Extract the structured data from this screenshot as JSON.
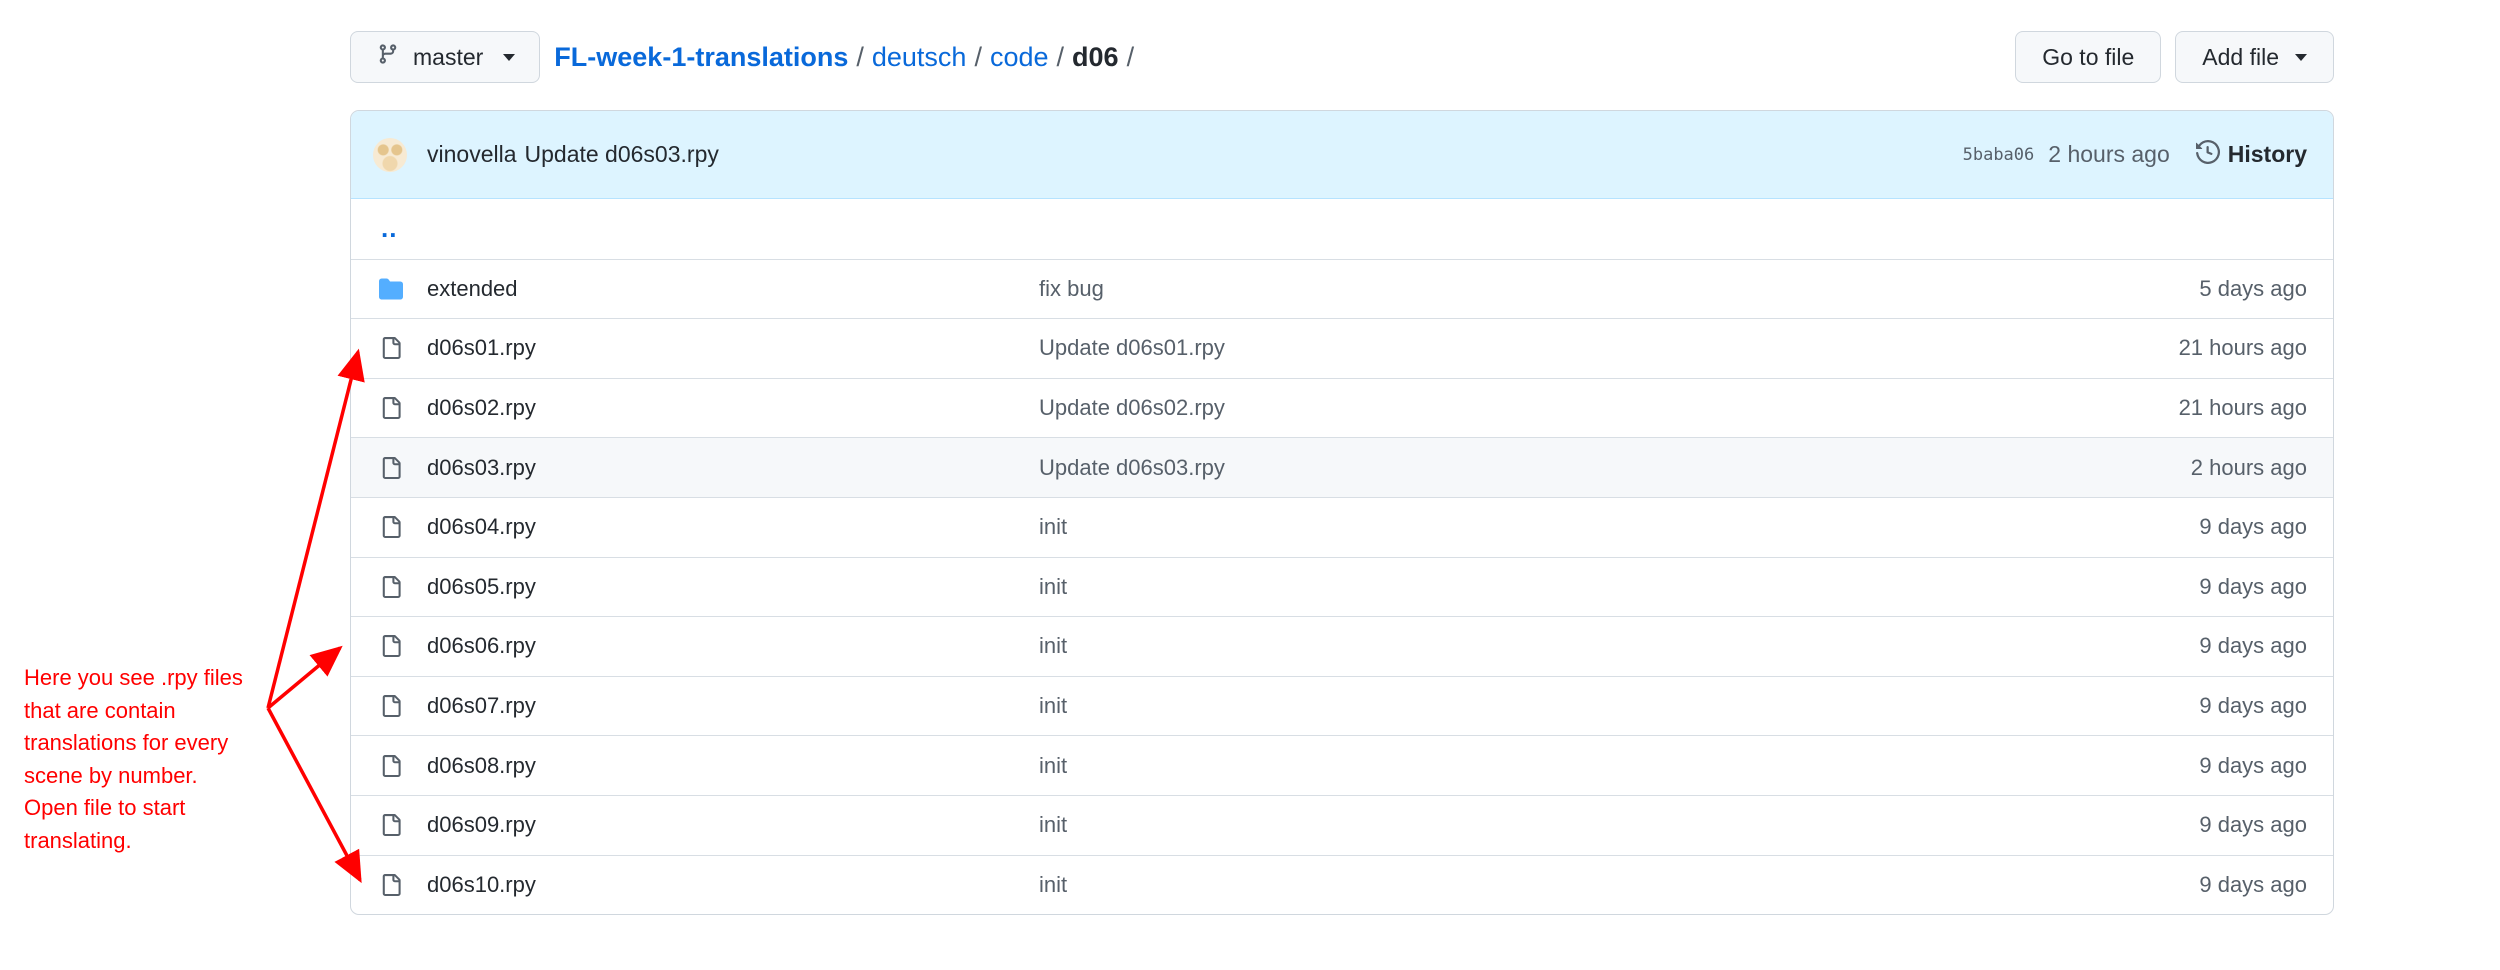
{
  "topbar": {
    "branch": "master",
    "breadcrumb": {
      "repo": "FL-week-1-translations",
      "sep": "/",
      "folder1": "deutsch",
      "folder2": "code",
      "current": "d06"
    },
    "go_to_file": "Go to file",
    "add_file": "Add file"
  },
  "commit": {
    "author": "vinovella",
    "message": "Update d06s03.rpy",
    "sha": "5baba06",
    "time": "2 hours ago",
    "history_label": "History"
  },
  "updir": "..",
  "files": [
    {
      "type": "folder",
      "name": "extended",
      "message": "fix bug",
      "time": "5 days ago"
    },
    {
      "type": "file",
      "name": "d06s01.rpy",
      "message": "Update d06s01.rpy",
      "time": "21 hours ago"
    },
    {
      "type": "file",
      "name": "d06s02.rpy",
      "message": "Update d06s02.rpy",
      "time": "21 hours ago"
    },
    {
      "type": "file",
      "name": "d06s03.rpy",
      "message": "Update d06s03.rpy",
      "time": "2 hours ago"
    },
    {
      "type": "file",
      "name": "d06s04.rpy",
      "message": "init",
      "time": "9 days ago"
    },
    {
      "type": "file",
      "name": "d06s05.rpy",
      "message": "init",
      "time": "9 days ago"
    },
    {
      "type": "file",
      "name": "d06s06.rpy",
      "message": "init",
      "time": "9 days ago"
    },
    {
      "type": "file",
      "name": "d06s07.rpy",
      "message": "init",
      "time": "9 days ago"
    },
    {
      "type": "file",
      "name": "d06s08.rpy",
      "message": "init",
      "time": "9 days ago"
    },
    {
      "type": "file",
      "name": "d06s09.rpy",
      "message": "init",
      "time": "9 days ago"
    },
    {
      "type": "file",
      "name": "d06s10.rpy",
      "message": "init",
      "time": "9 days ago"
    }
  ],
  "annotation": {
    "lines": [
      "Here you see .rpy files",
      "that are contain",
      "translations for every",
      "scene by number.",
      "Open file to start",
      "translating."
    ],
    "color": "#ff0000"
  },
  "colors": {
    "link": "#0969da",
    "commit_bar": "#ddf4ff",
    "folder_icon": "#54aeff"
  }
}
